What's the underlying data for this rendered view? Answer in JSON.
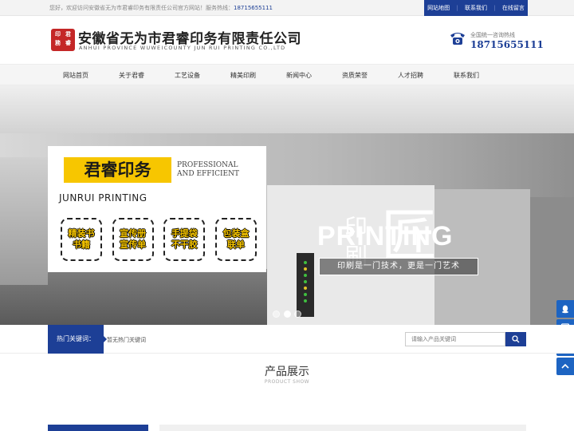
{
  "topbar": {
    "welcome": "您好，欢迎访问安徽省无为市君睿印务有限责任公司官方网站！服务热线：",
    "tel": "18715655111",
    "links": [
      "网站地图",
      "联系我们",
      "在线留言"
    ],
    "sep": "|"
  },
  "header": {
    "logo_chars": [
      "印",
      "君",
      "務",
      "睿"
    ],
    "company_cn": "安徽省无为市君睿印务有限责任公司",
    "company_en": "ANHUI PROVINCE WUWEICOUNTY  JUN RUI PRINTING CO.,LTD",
    "hotline_label": "全国统一咨询热线",
    "hotline_number": "18715655111"
  },
  "nav": {
    "items": [
      "网站首页",
      "关于君睿",
      "工艺设备",
      "精美印刷",
      "新闻中心",
      "资质荣誉",
      "人才招聘",
      "联系我们"
    ]
  },
  "banner": {
    "card_title": "君睿印务",
    "card_en_1": "PROFESSIONAL",
    "card_en_2": "AND EFFICIENT",
    "card_sub": "JUNRUI PRINTING",
    "boxes": [
      {
        "line1": "精装书",
        "line2": "书籍"
      },
      {
        "line1": "宣传册",
        "line2": "宣传单"
      },
      {
        "line1": "手提袋",
        "line2": "不干胶"
      },
      {
        "line1": "包装盒",
        "line2": "联单"
      }
    ],
    "vertical_text": "印刷",
    "big_char": "匠",
    "printing": "PRINTING",
    "slogan": "印刷是一门技术，更是一门艺术",
    "active_slide": 2,
    "slide_count": 3
  },
  "hot": {
    "label": "热门关键词：",
    "value": "暂无热门关键词"
  },
  "search": {
    "placeholder": "请输入产品关键词"
  },
  "products": {
    "title": "产品展示",
    "subtitle": "PRODUCT SHOW"
  },
  "colors": {
    "brand": "#1d3f96",
    "accent": "#f7c600",
    "seal": "#c42727",
    "side": "#1d64c2"
  },
  "icons": {
    "side": [
      "qq-icon",
      "contact-card-icon",
      "message-icon",
      "back-to-top-icon"
    ]
  }
}
